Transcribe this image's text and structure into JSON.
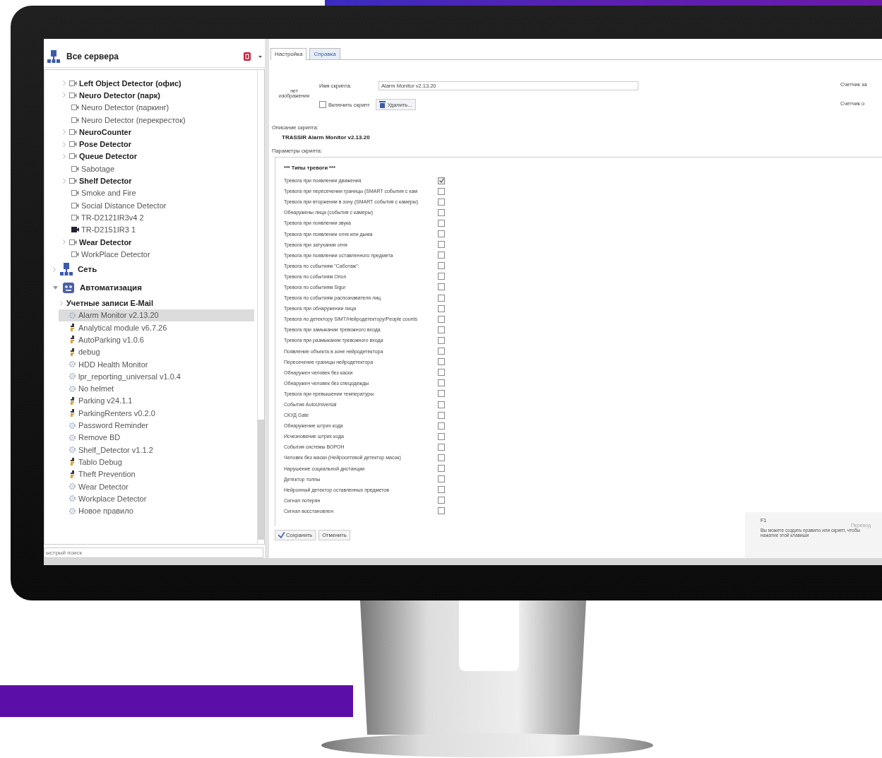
{
  "sidebar": {
    "title": "Все сервера",
    "camera_list": [
      {
        "label": "Left Object Detector (офис)",
        "bold": true,
        "kind": "camera-group",
        "expanded": false
      },
      {
        "label": "Neuro Detector (парк)",
        "bold": true,
        "kind": "camera-group",
        "expanded": false
      },
      {
        "label": "Neuro Detector (паркинг)",
        "bold": false,
        "kind": "camera"
      },
      {
        "label": "Neuro Detector (перекресток)",
        "bold": false,
        "kind": "camera"
      },
      {
        "label": "NeuroCounter",
        "bold": true,
        "kind": "camera-group",
        "expanded": false
      },
      {
        "label": "Pose Detector",
        "bold": true,
        "kind": "camera-group",
        "expanded": false
      },
      {
        "label": "Queue Detector",
        "bold": true,
        "kind": "camera-group",
        "expanded": false
      },
      {
        "label": "Sabotage",
        "bold": false,
        "kind": "camera"
      },
      {
        "label": "Shelf Detector",
        "bold": true,
        "kind": "camera-group",
        "expanded": false
      },
      {
        "label": "Smoke and Fire",
        "bold": false,
        "kind": "camera"
      },
      {
        "label": "Social Distance Detector",
        "bold": false,
        "kind": "camera"
      },
      {
        "label": "TR-D2121IR3v4 2",
        "bold": false,
        "kind": "camera"
      },
      {
        "label": "TR-D2151IR3 1",
        "bold": false,
        "kind": "camera-recording"
      },
      {
        "label": "Wear Detector",
        "bold": true,
        "kind": "camera-group",
        "expanded": false
      },
      {
        "label": "WorkPlace Detector",
        "bold": false,
        "kind": "camera"
      }
    ],
    "tree": [
      {
        "label": "Сеть",
        "bold": true,
        "kind": "network",
        "expanded": false,
        "selected": false
      },
      {
        "label": "Автоматизация",
        "bold": true,
        "kind": "automation",
        "expanded": true,
        "selected": false,
        "children": [
          {
            "label": "Учетные записи E-Mail",
            "bold": true,
            "kind": "folder",
            "expanded": false,
            "selected": false
          },
          {
            "label": "Alarm Monitor v2.13.20",
            "bold": false,
            "kind": "gear-script",
            "selected": true
          },
          {
            "label": "Analytical module v6.7.26",
            "bold": false,
            "kind": "python-script",
            "selected": false
          },
          {
            "label": "AutoParking v1.0.6",
            "bold": false,
            "kind": "python-script",
            "selected": false
          },
          {
            "label": "debug",
            "bold": false,
            "kind": "python-script",
            "selected": false
          },
          {
            "label": "HDD Health Monitor",
            "bold": false,
            "kind": "gear-script",
            "selected": false
          },
          {
            "label": "lpr_reporting_universal v1.0.4",
            "bold": false,
            "kind": "gear-script",
            "selected": false
          },
          {
            "label": "No helmet",
            "bold": false,
            "kind": "gear-script",
            "selected": false
          },
          {
            "label": "Parking v24.1.1",
            "bold": false,
            "kind": "python-script",
            "selected": false
          },
          {
            "label": "ParkingRenters v0.2.0",
            "bold": false,
            "kind": "python-script",
            "selected": false
          },
          {
            "label": "Password Reminder",
            "bold": false,
            "kind": "gear-script",
            "selected": false
          },
          {
            "label": "Remove BD",
            "bold": false,
            "kind": "gear-script",
            "selected": false
          },
          {
            "label": "Shelf_Detector v1.1.2",
            "bold": false,
            "kind": "gear-script",
            "selected": false
          },
          {
            "label": "Tablo Debug",
            "bold": false,
            "kind": "python-script",
            "selected": false
          },
          {
            "label": "Theft Prevention",
            "bold": false,
            "kind": "python-script",
            "selected": false
          },
          {
            "label": "Wear Detector",
            "bold": false,
            "kind": "gear-script",
            "selected": false
          },
          {
            "label": "Workplace Detector",
            "bold": false,
            "kind": "gear-script",
            "selected": false
          },
          {
            "label": "Новое правило",
            "bold": false,
            "kind": "gear-script",
            "selected": false
          }
        ]
      }
    ],
    "search": {
      "placeholder": "ыстрый поиск"
    }
  },
  "tabs": [
    {
      "label": "Настройка",
      "selected": true
    },
    {
      "label": "Справка",
      "selected": false
    }
  ],
  "script": {
    "image_placeholder": "нет изображения",
    "name_label": "Имя скрипта:",
    "name_value": "Alarm Monitor v2.13.20",
    "enable_label": "Включить скрипт",
    "enabled": false,
    "delete_button": "Удалить...",
    "counters": [
      "Счетчик за",
      "Счетчик о"
    ],
    "description_label": "Описание скрипта:",
    "description": "TRASSIR Alarm Monitor v2.13.20",
    "params_label": "Параметры скрипта:"
  },
  "params": {
    "heading": "*** Типы тревоги ***",
    "options": [
      {
        "label": "Тревога при появлении движения",
        "checked": true
      },
      {
        "label": "Тревога при пересечении границы (SMART события с кам",
        "checked": false
      },
      {
        "label": "Тревога при вторжении в зону (SMART события с камеры)",
        "checked": false
      },
      {
        "label": "Обнаружены лица (события с камеры)",
        "checked": false
      },
      {
        "label": "Тревога при появлении звука",
        "checked": false
      },
      {
        "label": "Тревога при появлении огня или дыма",
        "checked": false
      },
      {
        "label": "Тревога при затухании огня",
        "checked": false
      },
      {
        "label": "Тревога при появлении оставленного предмета",
        "checked": false
      },
      {
        "label": "Тревога по событиям \"Саботаж\":",
        "checked": false
      },
      {
        "label": "Тревога по событиям Orion",
        "checked": false
      },
      {
        "label": "Тревога по событиям Sigur",
        "checked": false
      },
      {
        "label": "Тревога по событиям распознавателя лиц",
        "checked": false
      },
      {
        "label": "Тревога при обнаружении лица",
        "checked": false
      },
      {
        "label": "Тревога по детектору SIMT/Нейродетектору/People counts",
        "checked": false
      },
      {
        "label": "Тревога при замыкании тревожного входа",
        "checked": false
      },
      {
        "label": "Тревога при размыкании тревожного входа",
        "checked": false
      },
      {
        "label": "Появление объекта в зоне нейродетектора",
        "checked": false
      },
      {
        "label": "Пересечение границы нейродетектора",
        "checked": false
      },
      {
        "label": "Обнаружен человек без каски",
        "checked": false
      },
      {
        "label": "Обнаружен человек без спецодежды",
        "checked": false
      },
      {
        "label": "Тревога при превышении температуры",
        "checked": false
      },
      {
        "label": "События AutoUniversal",
        "checked": false
      },
      {
        "label": "СКУД Gate",
        "checked": false
      },
      {
        "label": "Обнаружение штрих кода",
        "checked": false
      },
      {
        "label": "Исчезновение штрих кода",
        "checked": false
      },
      {
        "label": "События системы ВОРОН",
        "checked": false
      },
      {
        "label": "Человек без маски (Нейросетевой детектор масок)",
        "checked": false
      },
      {
        "label": "Нарушение социальной дистанции",
        "checked": false
      },
      {
        "label": "Детектор толпы",
        "checked": false
      },
      {
        "label": "Нейронный детектор оставленных предметов",
        "checked": false
      },
      {
        "label": "Сигнал потерян",
        "checked": false
      },
      {
        "label": "Сигнал восстановлен",
        "checked": false
      }
    ]
  },
  "actions": [
    "Сохранить",
    "Отменить"
  ],
  "help": {
    "key": "F1",
    "link": "Перевод",
    "text": [
      "Вы можете создать правило или скрипт, чтобы",
      "нажатие этой клавиши"
    ]
  }
}
